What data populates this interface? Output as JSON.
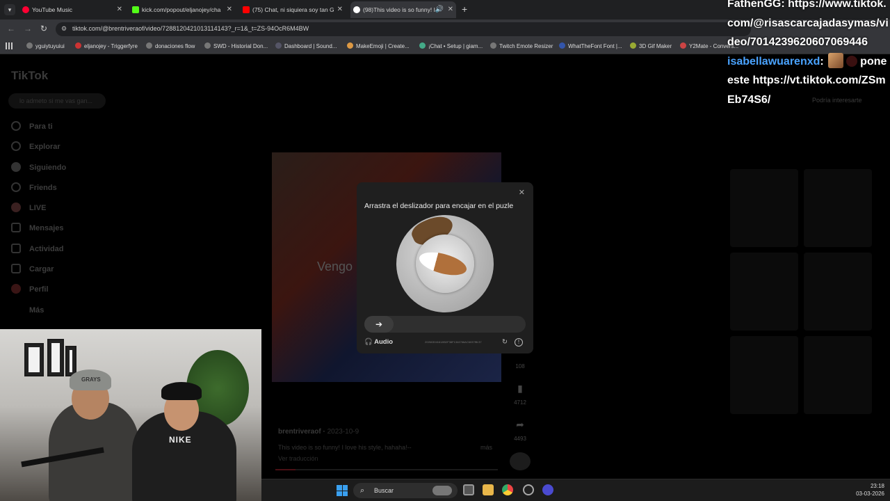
{
  "browser": {
    "tabs": [
      {
        "label": "YouTube Music",
        "color": "#ff0033"
      },
      {
        "label": "kick.com/popout/eljanojey/cha",
        "color": "#53fc18"
      },
      {
        "label": "(75) Chat, ni siquiera soy tan G",
        "color": "#ff0000"
      },
      {
        "label": "(98)This video is so funny! I",
        "color": "#ffffff"
      }
    ],
    "url": "tiktok.com/@brentriveraof/video/7288120421013114143?_r=1&_t=ZS-94OcR6M4BW",
    "bookmarks": [
      "yguiytuyuiui",
      "eljanojey - Triggerfyre",
      "donaciones flow",
      "SWD - Historial Don...",
      "Dashboard | Sound...",
      "MakeEmoji | Create...",
      "¡Chat • Setup | giam...",
      "Twitch Emote Resizer",
      "WhatTheFont Font |...",
      "3D Gif Maker",
      "Y2Mate - Convers..."
    ]
  },
  "tiktok": {
    "logo": "TikTok",
    "search_placeholder": "lo admeto si me vas gan...",
    "nav": [
      "Para ti",
      "Explorar",
      "Siguiendo",
      "Friends",
      "LIVE",
      "Mensajes",
      "Actividad",
      "Cargar",
      "Perfil",
      "Más"
    ],
    "video_text": "Vengo",
    "counts": [
      "108",
      "4712",
      "4493"
    ],
    "author": "brentriveraof",
    "date": "2023-10-9",
    "caption": "This video is so funny! I love his style, hahaha!--",
    "more": "más",
    "translate": "Ver traducción",
    "suggest": "Podría interesarte",
    "progress": 0.09
  },
  "captcha": {
    "title": "Arrastra el deslizador para encajar en el puzle",
    "audio": "Audio",
    "code": "202603041618f32F38F1344766AC6037ff6:37"
  },
  "chat": {
    "line1_user": "FathenGG:",
    "line1_text": "https://www.tiktok.com/@risascarcajadasymas/video/7014239620607069446",
    "line2_user": "isabellawuarenxd",
    "line2_text": "pone este https://vt.tiktok.com/ZSmEb74S6/"
  },
  "webcam": {
    "cap_text": "GRAYS",
    "shirt_text": "NIKE"
  },
  "taskbar": {
    "search": "Buscar",
    "time": "23:18",
    "date": "03-03-2026"
  }
}
